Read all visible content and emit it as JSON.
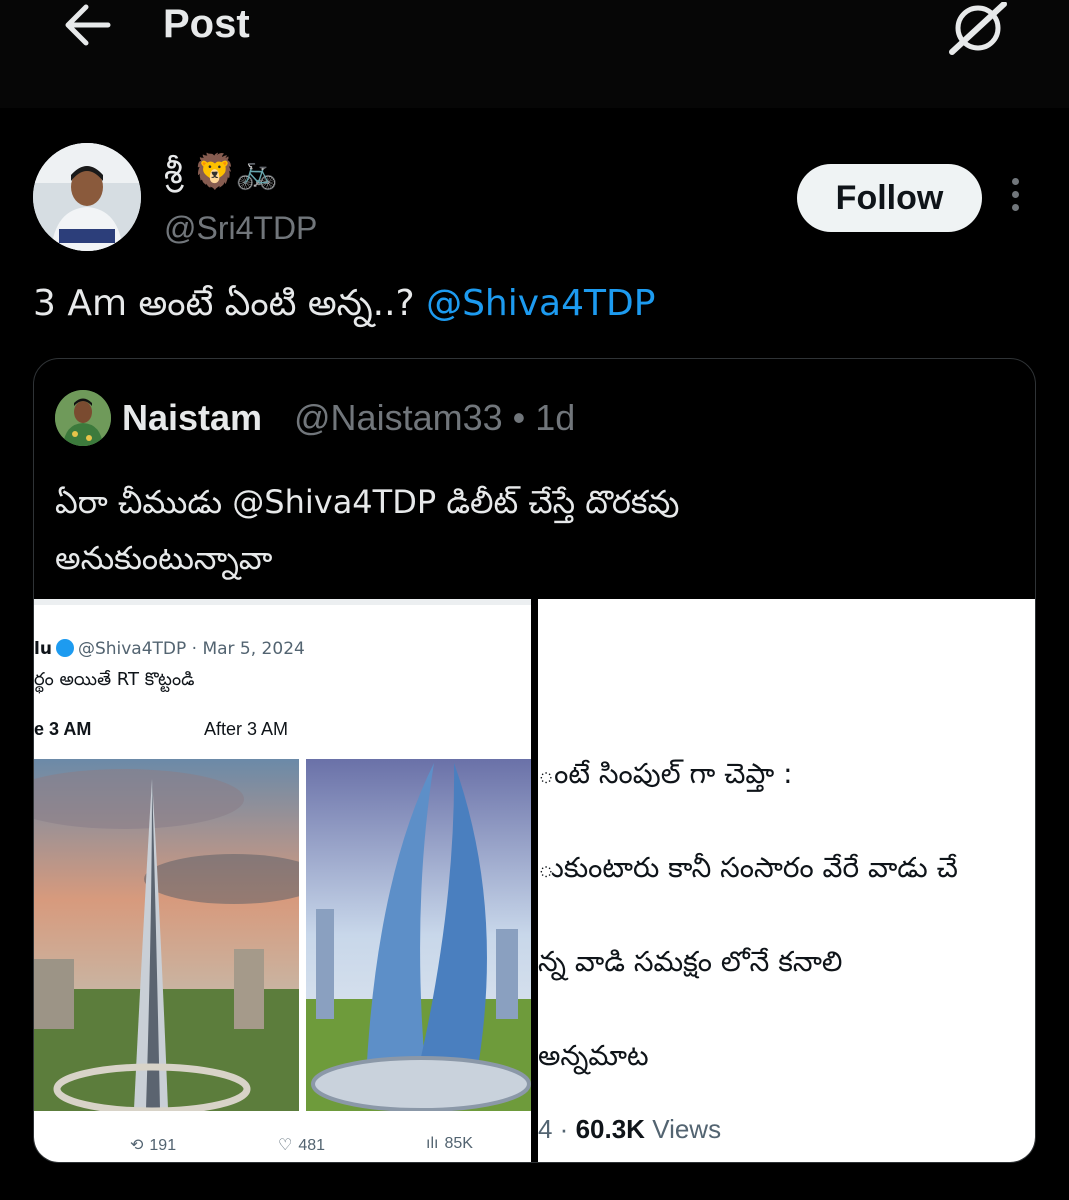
{
  "header": {
    "title": "Post",
    "back_icon": "back-arrow-icon",
    "grok_icon": "grok-icon"
  },
  "author": {
    "display_name": "శ్రీ 🦁🚲",
    "handle": "@Sri4TDP",
    "follow_label": "Follow"
  },
  "tweet": {
    "text": "3 Am  అంటే ఏంటి అన్న..? ",
    "mention": "@Shiva4TDP"
  },
  "quote": {
    "name": "Naistam",
    "meta": "@Naistam33 • 1d",
    "text_line1": "ఏరా చీముడు @Shiva4TDP డిలీట్ చేస్తే దొరకవు",
    "text_line2": "అనుకుంటున్నావా",
    "left_image": {
      "meta_prefix": "lu",
      "meta": "@Shiva4TDP · Mar 5, 2024",
      "text": "ర్థం అయితే RT కొట్టండి",
      "before_label": "e 3 AM",
      "after_label": "After 3 AM",
      "retweets": "191",
      "likes": "481",
      "views": "85K"
    },
    "right_image": {
      "line1": "ంటే సింపుల్ గా చెప్తా :",
      "line2": "ుకుంటారు కానీ సంసారం వేరే వాడు చే",
      "line3": "న్న వాడి సమక్షం లోనే కనాలి",
      "line4": "అన్నమాట",
      "views_prefix": "4 · ",
      "views_count": "60.3K",
      "views_label": " Views"
    }
  },
  "colors": {
    "background": "#000000",
    "text": "#e7e9ea",
    "muted": "#71767b",
    "link": "#1d9bf0",
    "button_bg": "#eff3f4"
  }
}
